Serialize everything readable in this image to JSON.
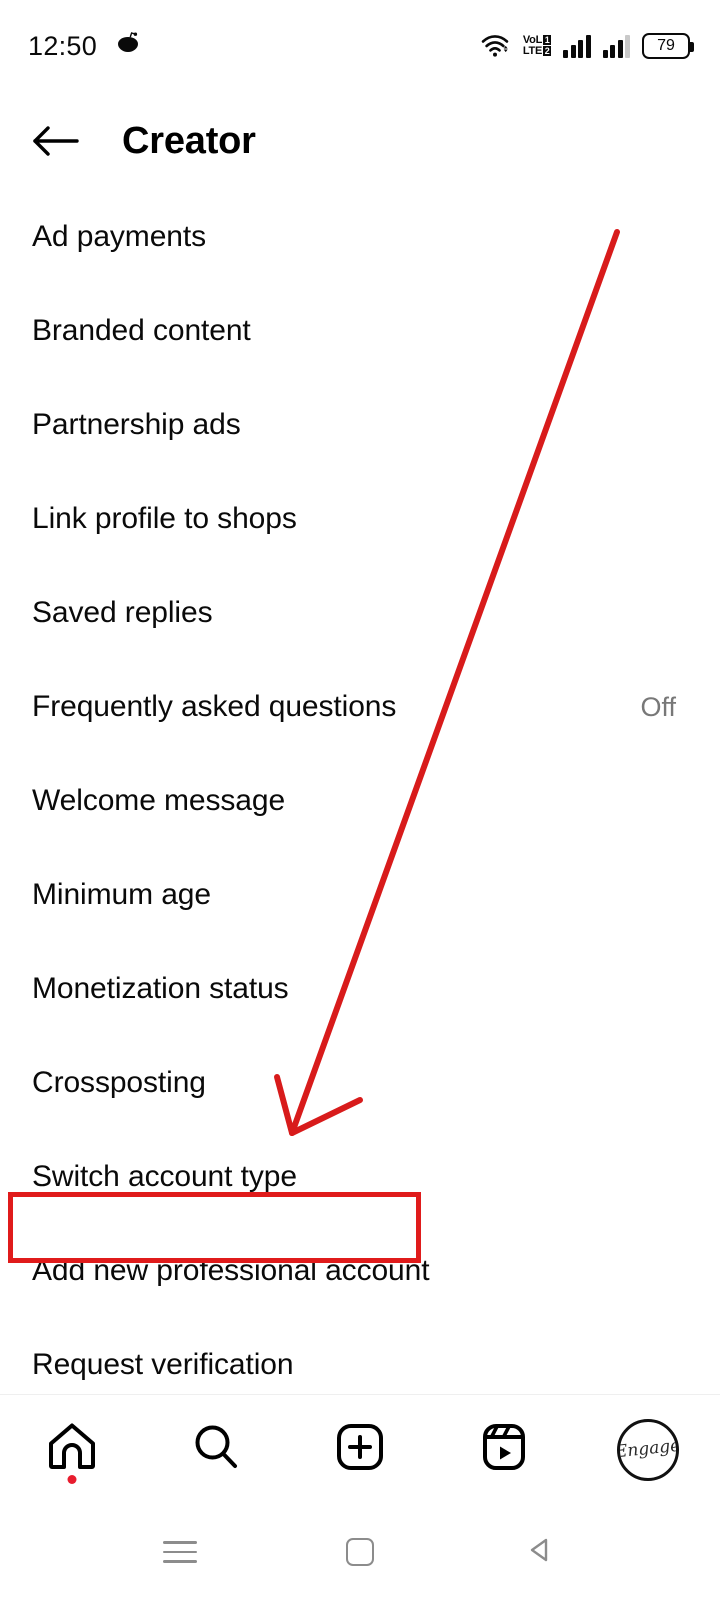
{
  "status_bar": {
    "time": "12:50",
    "notification_icon": "reddit-alien-icon",
    "icons": {
      "wifi": "wifi-icon",
      "volte_top": "VoL",
      "volte_bottom": "LTE",
      "volte_badge_top": "1",
      "volte_badge_bottom": "2",
      "signal_1": "signal-bars-icon",
      "signal_2": "signal-bars-icon"
    },
    "battery_percent": "79"
  },
  "header": {
    "back_icon": "back-arrow-icon",
    "title": "Creator"
  },
  "menu": {
    "items": [
      {
        "label": "Ad payments",
        "value": ""
      },
      {
        "label": "Branded content",
        "value": ""
      },
      {
        "label": "Partnership ads",
        "value": ""
      },
      {
        "label": "Link profile to shops",
        "value": ""
      },
      {
        "label": "Saved replies",
        "value": ""
      },
      {
        "label": "Frequently asked questions",
        "value": "Off"
      },
      {
        "label": "Welcome message",
        "value": ""
      },
      {
        "label": "Minimum age",
        "value": ""
      },
      {
        "label": "Monetization status",
        "value": ""
      },
      {
        "label": "Crossposting",
        "value": ""
      },
      {
        "label": "Switch account type",
        "value": ""
      },
      {
        "label": "Add new professional account",
        "value": ""
      },
      {
        "label": "Request verification",
        "value": ""
      }
    ]
  },
  "annotation": {
    "color": "#e01b1b",
    "highlighted_item": "Switch account type",
    "arrow": "red-arrow-pointing-to-switch-account-type"
  },
  "tab_bar": {
    "tabs": [
      {
        "name": "home",
        "icon": "home-icon",
        "badge": true
      },
      {
        "name": "search",
        "icon": "search-icon",
        "badge": false
      },
      {
        "name": "create",
        "icon": "plus-square-icon",
        "badge": false
      },
      {
        "name": "reels",
        "icon": "reels-icon",
        "badge": false
      },
      {
        "name": "profile",
        "icon": "avatar-icon",
        "badge": false
      }
    ],
    "avatar_text": "Engage"
  },
  "system_nav": {
    "recents_icon": "menu-lines-icon",
    "home_icon": "home-square-icon",
    "back_icon": "back-triangle-icon"
  }
}
